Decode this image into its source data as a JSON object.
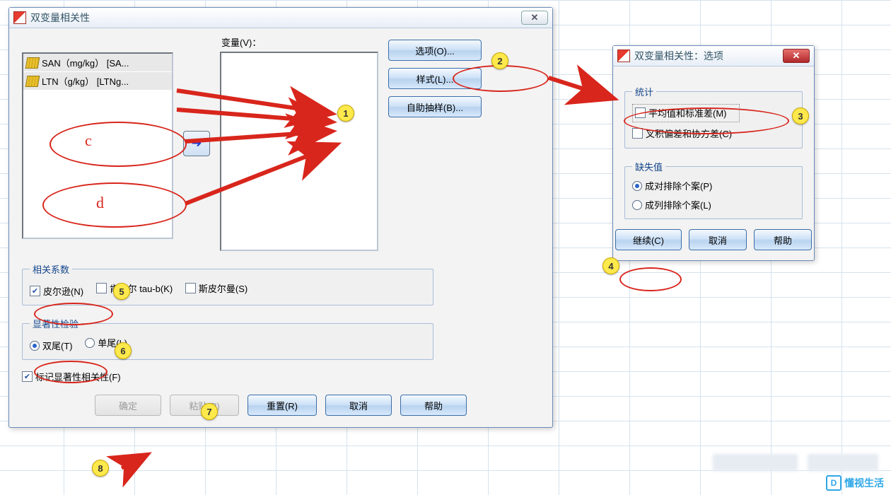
{
  "main_dialog": {
    "title": "双变量相关性",
    "close_glyph": "✕",
    "source_list": [
      "SAN（mg/kg） [SA...",
      "LTN（g/kg） [LTNg..."
    ],
    "vars_label": "变量(V)：",
    "move_glyph": "➜",
    "side_buttons": {
      "options": "选项(O)...",
      "style": "样式(L)...",
      "bootstrap": "自助抽样(B)..."
    },
    "coef_group": {
      "legend": "相关系数",
      "pearson": "皮尔逊(N)",
      "kendall": "肯德尔 tau-b(K)",
      "spearman": "斯皮尔曼(S)",
      "pearson_checked": true,
      "kendall_checked": false,
      "spearman_checked": false
    },
    "sig_group": {
      "legend": "显著性检验",
      "two_tail": "双尾(T)",
      "one_tail": "单尾(L)",
      "selected": "two_tail"
    },
    "flag_check": {
      "label": "标记显著性相关性(F)",
      "checked": true
    },
    "bottom": {
      "ok": "确定",
      "paste": "粘贴(P)",
      "reset": "重置(R)",
      "cancel": "取消",
      "help": "帮助"
    }
  },
  "options_dialog": {
    "title": "双变量相关性：选项",
    "close_glyph": "✕",
    "stats_group": {
      "legend": "统计",
      "mean_sd": "平均值和标准差(M)",
      "cross_cov": "叉积偏差和协方差(C)",
      "mean_sd_checked": false,
      "cross_cov_checked": false
    },
    "missing_group": {
      "legend": "缺失值",
      "pairwise": "成对排除个案(P)",
      "listwise": "成列排除个案(L)",
      "selected": "pairwise"
    },
    "bottom": {
      "continue": "继续(C)",
      "cancel": "取消",
      "help": "帮助"
    }
  },
  "annotations": {
    "badges": {
      "1": "1",
      "2": "2",
      "3": "3",
      "4": "4",
      "5": "5",
      "6": "6",
      "7": "7",
      "8": "8"
    },
    "letters": {
      "c": "c",
      "d": "d"
    }
  },
  "watermark": {
    "text": "懂视生活",
    "icon": "D"
  }
}
